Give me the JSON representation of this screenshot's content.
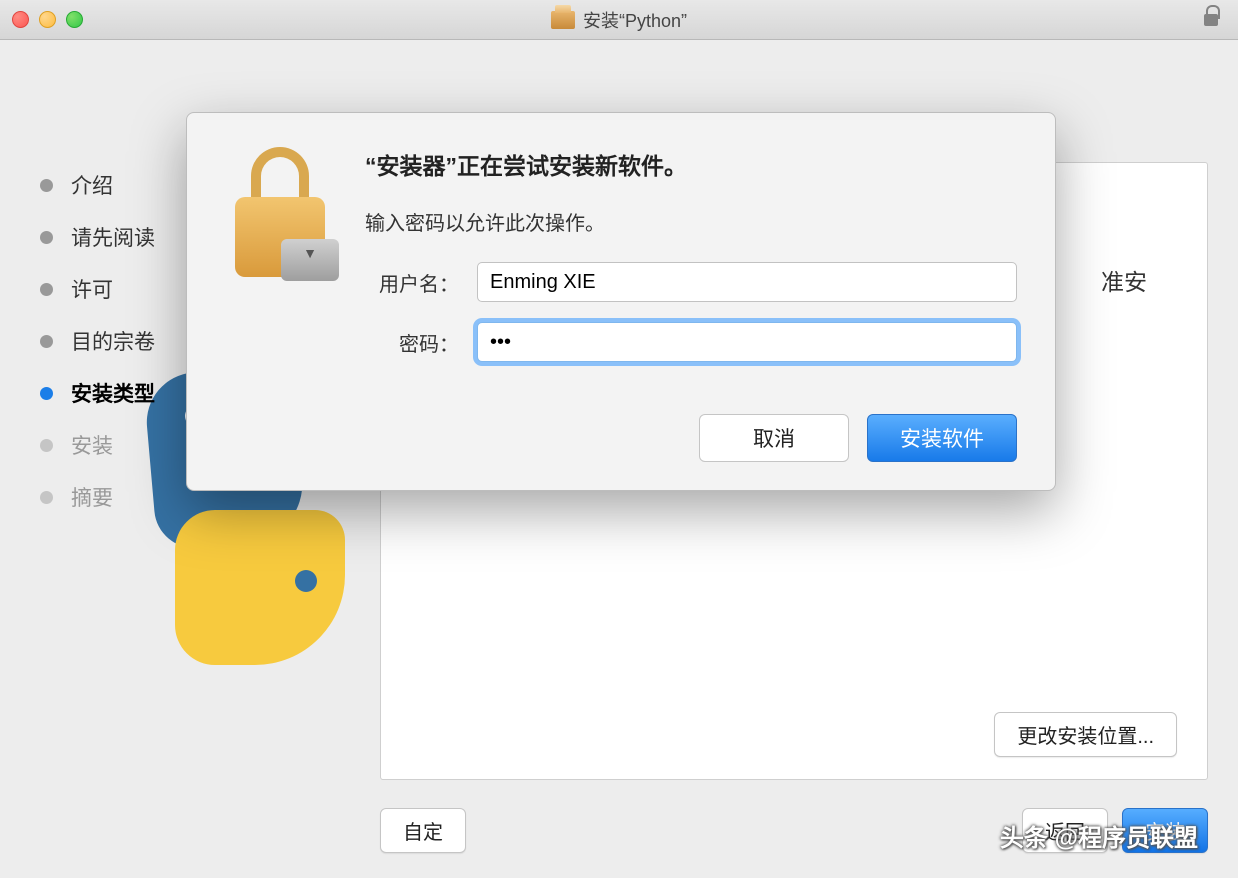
{
  "window": {
    "title": "安装“Python”"
  },
  "steps": [
    {
      "label": "介绍",
      "state": "done"
    },
    {
      "label": "请先阅读",
      "state": "done"
    },
    {
      "label": "许可",
      "state": "done"
    },
    {
      "label": "目的宗卷",
      "state": "done"
    },
    {
      "label": "安装类型",
      "state": "active"
    },
    {
      "label": "安装",
      "state": "pending"
    },
    {
      "label": "摘要",
      "state": "pending"
    }
  ],
  "panel": {
    "title_fragment": "准安"
  },
  "buttons": {
    "change_location": "更改安装位置...",
    "customize": "自定",
    "back": "返回",
    "install": "安装"
  },
  "dialog": {
    "heading": "“安装器”正在尝试安装新软件。",
    "subtext": "输入密码以允许此次操作。",
    "username_label": "用户名：",
    "password_label": "密码：",
    "username_value": "Enming XIE",
    "password_value": "•••",
    "cancel": "取消",
    "confirm": "安装软件"
  },
  "watermark": "头条 @程序员联盟"
}
